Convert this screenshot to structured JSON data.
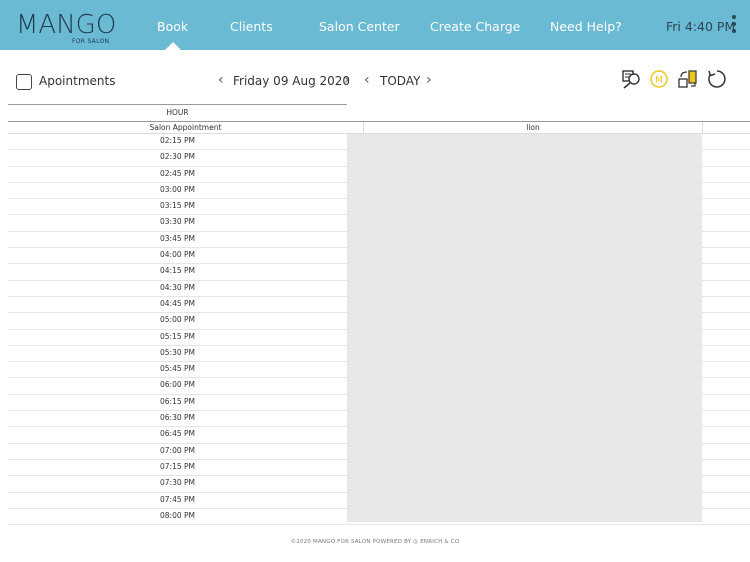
{
  "header": {
    "logo_text": "MANGO",
    "logo_subtitle": "FOR SALON",
    "nav": [
      {
        "label": "Book",
        "active": true
      },
      {
        "label": "Clients",
        "active": false
      },
      {
        "label": "Salon Center",
        "active": false
      },
      {
        "label": "Create Charge",
        "active": false
      },
      {
        "label": "Need Help?",
        "active": false
      }
    ],
    "clock": "Fri 4:40 PM",
    "menu_icon": "more-vertical-icon",
    "brand_color": "#6bbad3"
  },
  "toolbar": {
    "section_icon": "calendar-edit-icon",
    "section_label": "Apointments",
    "date_label": "Friday 09 Aug 2020",
    "today_label": "TODAY",
    "icons": [
      "search-list-icon",
      "member-m-icon",
      "transfer-icon",
      "refresh-icon"
    ]
  },
  "schedule": {
    "hour_header": "HOUR",
    "columns": [
      "Salon Appointment",
      "lion"
    ],
    "times": [
      "02:15 PM",
      "02:30 PM",
      "02:45 PM",
      "03:00 PM",
      "03:15 PM",
      "03:30 PM",
      "03:45 PM",
      "04:00 PM",
      "04:15 PM",
      "04:30 PM",
      "04:45 PM",
      "05:00 PM",
      "05:15 PM",
      "05:30 PM",
      "05:45 PM",
      "06:00 PM",
      "06:15 PM",
      "06:30 PM",
      "06:45 PM",
      "07:00 PM",
      "07:15 PM",
      "07:30 PM",
      "07:45 PM",
      "08:00 PM"
    ]
  },
  "footer": {
    "text": "©2020 MANGO FOR SALON POWERED BY",
    "brand": "ENRICH & CO"
  }
}
